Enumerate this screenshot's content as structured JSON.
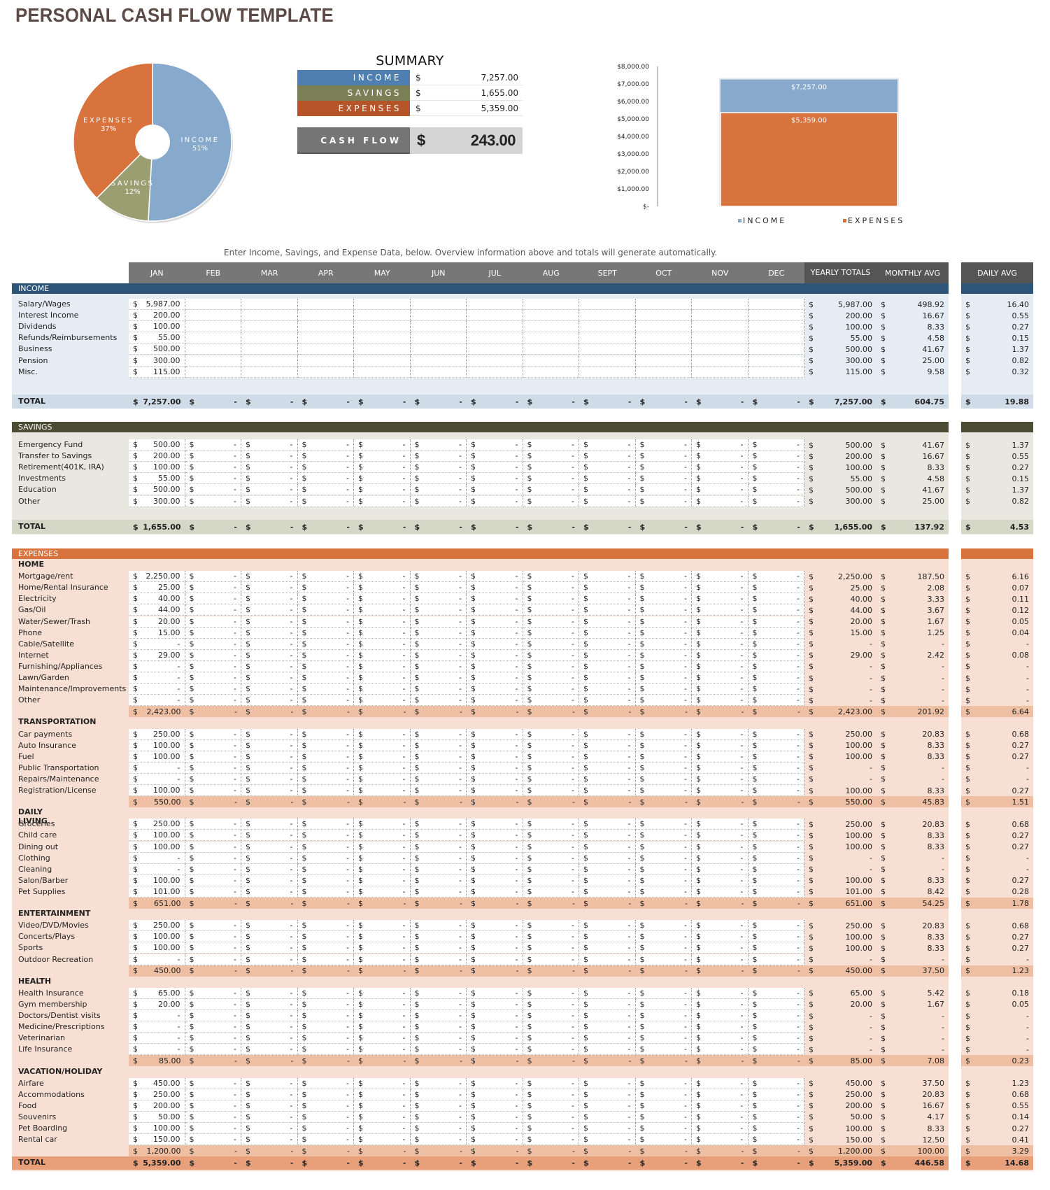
{
  "title": "PERSONAL CASH FLOW TEMPLATE",
  "colors": {
    "income": "#4e7fb0",
    "income_light": "#86a9cc",
    "savings": "#7a7f55",
    "savings_light": "#9a9e71",
    "expenses": "#b6542a",
    "expenses_light": "#d8733e",
    "income_band": "#2e5478",
    "savings_band": "#4a4c34",
    "expenses_band": "#d8733e",
    "income_bg": "#e6ecf3",
    "savings_bg": "#e8e8e0",
    "expenses_bg": "#f7e0d3",
    "income_total": "#cfdbe7",
    "savings_total": "#d5d7c7",
    "expenses_sub": "#eebfa2",
    "expenses_total": "#e8a07a"
  },
  "summary": {
    "title": "SUMMARY",
    "rows": [
      {
        "label": "INCOME",
        "currency": "$",
        "value": "7,257.00"
      },
      {
        "label": "SAVINGS",
        "currency": "$",
        "value": "1,655.00"
      },
      {
        "label": "EXPENSES",
        "currency": "$",
        "value": "5,359.00"
      }
    ],
    "cash_flow": {
      "label": "CASH FLOW",
      "currency": "$",
      "value": "243.00"
    }
  },
  "chart_data": [
    {
      "type": "pie",
      "title": "",
      "donut": true,
      "slices": [
        {
          "label": "INCOME",
          "percent": "51%",
          "value": 7257
        },
        {
          "label": "SAVINGS",
          "percent": "12%",
          "value": 1655
        },
        {
          "label": "EXPENSES",
          "percent": "37%",
          "value": 5359
        }
      ]
    },
    {
      "type": "bar",
      "stacked_overlap": true,
      "categories": [
        ""
      ],
      "series": [
        {
          "name": "INCOME",
          "values": [
            7257
          ],
          "label": "$7,257.00"
        },
        {
          "name": "EXPENSES",
          "values": [
            5359
          ],
          "label": "$5,359.00"
        }
      ],
      "ylim": [
        0,
        8000
      ],
      "yticks": [
        "$-",
        "$1,000.00",
        "$2,000.00",
        "$3,000.00",
        "$4,000.00",
        "$5,000.00",
        "$6,000.00",
        "$7,000.00",
        "$8,000.00"
      ],
      "legend": [
        "INCOME",
        "EXPENSES"
      ],
      "legend_position": "bottom"
    }
  ],
  "instructions": "Enter Income, Savings, and Expense Data, below.  Overview information above and totals will generate automatically.",
  "columns": {
    "months": [
      "JAN",
      "FEB",
      "MAR",
      "APR",
      "MAY",
      "JUN",
      "JUL",
      "AUG",
      "SEPT",
      "OCT",
      "NOV",
      "DEC"
    ],
    "yearly": "YEARLY TOTALS",
    "monthly_avg": "MONTHLY AVG",
    "daily_avg": "DAILY AVG"
  },
  "income": {
    "header": "INCOME",
    "rows": [
      {
        "label": "Salary/Wages",
        "jan": "5,987.00",
        "yearly": "5,987.00",
        "monthly": "498.92",
        "daily": "16.40"
      },
      {
        "label": "Interest Income",
        "jan": "200.00",
        "yearly": "200.00",
        "monthly": "16.67",
        "daily": "0.55"
      },
      {
        "label": "Dividends",
        "jan": "100.00",
        "yearly": "100.00",
        "monthly": "8.33",
        "daily": "0.27"
      },
      {
        "label": "Refunds/Reimbursements",
        "jan": "55.00",
        "yearly": "55.00",
        "monthly": "4.58",
        "daily": "0.15"
      },
      {
        "label": "Business",
        "jan": "500.00",
        "yearly": "500.00",
        "monthly": "41.67",
        "daily": "1.37"
      },
      {
        "label": "Pension",
        "jan": "300.00",
        "yearly": "300.00",
        "monthly": "25.00",
        "daily": "0.82"
      },
      {
        "label": "Misc.",
        "jan": "115.00",
        "yearly": "115.00",
        "monthly": "9.58",
        "daily": "0.32"
      }
    ],
    "total": {
      "label": "TOTAL",
      "jan": "7,257.00",
      "yearly": "7,257.00",
      "monthly": "604.75",
      "daily": "19.88"
    }
  },
  "savings": {
    "header": "SAVINGS",
    "rows": [
      {
        "label": "Emergency Fund",
        "jan": "500.00",
        "yearly": "500.00",
        "monthly": "41.67",
        "daily": "1.37"
      },
      {
        "label": "Transfer to Savings",
        "jan": "200.00",
        "yearly": "200.00",
        "monthly": "16.67",
        "daily": "0.55"
      },
      {
        "label": "Retirement(401K, IRA)",
        "jan": "100.00",
        "yearly": "100.00",
        "monthly": "8.33",
        "daily": "0.27"
      },
      {
        "label": "Investments",
        "jan": "55.00",
        "yearly": "55.00",
        "monthly": "4.58",
        "daily": "0.15"
      },
      {
        "label": "Education",
        "jan": "500.00",
        "yearly": "500.00",
        "monthly": "41.67",
        "daily": "1.37"
      },
      {
        "label": "Other",
        "jan": "300.00",
        "yearly": "300.00",
        "monthly": "25.00",
        "daily": "0.82"
      }
    ],
    "total": {
      "label": "TOTAL",
      "jan": "1,655.00",
      "yearly": "1,655.00",
      "monthly": "137.92",
      "daily": "4.53"
    }
  },
  "expenses": {
    "header": "EXPENSES",
    "categories": [
      {
        "name": "HOME",
        "rows": [
          {
            "label": "Mortgage/rent",
            "jan": "2,250.00",
            "yearly": "2,250.00",
            "monthly": "187.50",
            "daily": "6.16"
          },
          {
            "label": "Home/Rental Insurance",
            "jan": "25.00",
            "yearly": "25.00",
            "monthly": "2.08",
            "daily": "0.07"
          },
          {
            "label": "Electricity",
            "jan": "40.00",
            "yearly": "40.00",
            "monthly": "3.33",
            "daily": "0.11"
          },
          {
            "label": "Gas/Oil",
            "jan": "44.00",
            "yearly": "44.00",
            "monthly": "3.67",
            "daily": "0.12"
          },
          {
            "label": "Water/Sewer/Trash",
            "jan": "20.00",
            "yearly": "20.00",
            "monthly": "1.67",
            "daily": "0.05"
          },
          {
            "label": "Phone",
            "jan": "15.00",
            "yearly": "15.00",
            "monthly": "1.25",
            "daily": "0.04"
          },
          {
            "label": "Cable/Satellite",
            "jan": "-",
            "yearly": "-",
            "monthly": "-",
            "daily": "-"
          },
          {
            "label": "Internet",
            "jan": "29.00",
            "yearly": "29.00",
            "monthly": "2.42",
            "daily": "0.08"
          },
          {
            "label": "Furnishing/Appliances",
            "jan": "-",
            "yearly": "-",
            "monthly": "-",
            "daily": "-"
          },
          {
            "label": "Lawn/Garden",
            "jan": "-",
            "yearly": "-",
            "monthly": "-",
            "daily": "-"
          },
          {
            "label": "Maintenance/Improvements",
            "jan": "-",
            "yearly": "-",
            "monthly": "-",
            "daily": "-"
          },
          {
            "label": "Other",
            "jan": "-",
            "yearly": "-",
            "monthly": "-",
            "daily": "-"
          }
        ],
        "subtotal": {
          "jan": "2,423.00",
          "yearly": "2,423.00",
          "monthly": "201.92",
          "daily": "6.64"
        }
      },
      {
        "name": "TRANSPORTATION",
        "rows": [
          {
            "label": "Car payments",
            "jan": "250.00",
            "yearly": "250.00",
            "monthly": "20.83",
            "daily": "0.68"
          },
          {
            "label": "Auto Insurance",
            "jan": "100.00",
            "yearly": "100.00",
            "monthly": "8.33",
            "daily": "0.27"
          },
          {
            "label": "Fuel",
            "jan": "100.00",
            "yearly": "100.00",
            "monthly": "8.33",
            "daily": "0.27"
          },
          {
            "label": "Public Transportation",
            "jan": "-",
            "yearly": "-",
            "monthly": "-",
            "daily": "-"
          },
          {
            "label": "Repairs/Maintenance",
            "jan": "-",
            "yearly": "-",
            "monthly": "-",
            "daily": "-"
          },
          {
            "label": "Registration/License",
            "jan": "100.00",
            "yearly": "100.00",
            "monthly": "8.33",
            "daily": "0.27"
          }
        ],
        "subtotal": {
          "jan": "550.00",
          "yearly": "550.00",
          "monthly": "45.83",
          "daily": "1.51"
        }
      },
      {
        "name": "DAILY LIVING",
        "rows": [
          {
            "label": "Groceries",
            "jan": "250.00",
            "yearly": "250.00",
            "monthly": "20.83",
            "daily": "0.68"
          },
          {
            "label": "Child care",
            "jan": "100.00",
            "yearly": "100.00",
            "monthly": "8.33",
            "daily": "0.27"
          },
          {
            "label": "Dining out",
            "jan": "100.00",
            "yearly": "100.00",
            "monthly": "8.33",
            "daily": "0.27"
          },
          {
            "label": "Clothing",
            "jan": "-",
            "yearly": "-",
            "monthly": "-",
            "daily": "-"
          },
          {
            "label": "Cleaning",
            "jan": "-",
            "yearly": "-",
            "monthly": "-",
            "daily": "-"
          },
          {
            "label": "Salon/Barber",
            "jan": "100.00",
            "yearly": "100.00",
            "monthly": "8.33",
            "daily": "0.27"
          },
          {
            "label": "Pet Supplies",
            "jan": "101.00",
            "yearly": "101.00",
            "monthly": "8.42",
            "daily": "0.28"
          }
        ],
        "subtotal": {
          "jan": "651.00",
          "yearly": "651.00",
          "monthly": "54.25",
          "daily": "1.78"
        }
      },
      {
        "name": "ENTERTAINMENT",
        "rows": [
          {
            "label": "Video/DVD/Movies",
            "jan": "250.00",
            "yearly": "250.00",
            "monthly": "20.83",
            "daily": "0.68"
          },
          {
            "label": "Concerts/Plays",
            "jan": "100.00",
            "yearly": "100.00",
            "monthly": "8.33",
            "daily": "0.27"
          },
          {
            "label": "Sports",
            "jan": "100.00",
            "yearly": "100.00",
            "monthly": "8.33",
            "daily": "0.27"
          },
          {
            "label": "Outdoor Recreation",
            "jan": "-",
            "yearly": "-",
            "monthly": "-",
            "daily": "-"
          }
        ],
        "subtotal": {
          "jan": "450.00",
          "yearly": "450.00",
          "monthly": "37.50",
          "daily": "1.23"
        }
      },
      {
        "name": "HEALTH",
        "rows": [
          {
            "label": "Health Insurance",
            "jan": "65.00",
            "yearly": "65.00",
            "monthly": "5.42",
            "daily": "0.18"
          },
          {
            "label": "Gym membership",
            "jan": "20.00",
            "yearly": "20.00",
            "monthly": "1.67",
            "daily": "0.05"
          },
          {
            "label": "Doctors/Dentist visits",
            "jan": "-",
            "yearly": "-",
            "monthly": "-",
            "daily": "-"
          },
          {
            "label": "Medicine/Prescriptions",
            "jan": "-",
            "yearly": "-",
            "monthly": "-",
            "daily": "-"
          },
          {
            "label": "Veterinarian",
            "jan": "-",
            "yearly": "-",
            "monthly": "-",
            "daily": "-"
          },
          {
            "label": "Life Insurance",
            "jan": "-",
            "yearly": "-",
            "monthly": "-",
            "daily": "-"
          }
        ],
        "subtotal": {
          "jan": "85.00",
          "yearly": "85.00",
          "monthly": "7.08",
          "daily": "0.23"
        }
      },
      {
        "name": "VACATION/HOLIDAY",
        "rows": [
          {
            "label": "Airfare",
            "jan": "450.00",
            "yearly": "450.00",
            "monthly": "37.50",
            "daily": "1.23"
          },
          {
            "label": "Accommodations",
            "jan": "250.00",
            "yearly": "250.00",
            "monthly": "20.83",
            "daily": "0.68"
          },
          {
            "label": "Food",
            "jan": "200.00",
            "yearly": "200.00",
            "monthly": "16.67",
            "daily": "0.55"
          },
          {
            "label": "Souvenirs",
            "jan": "50.00",
            "yearly": "50.00",
            "monthly": "4.17",
            "daily": "0.14"
          },
          {
            "label": "Pet Boarding",
            "jan": "100.00",
            "yearly": "100.00",
            "monthly": "8.33",
            "daily": "0.27"
          },
          {
            "label": "Rental car",
            "jan": "150.00",
            "yearly": "150.00",
            "monthly": "12.50",
            "daily": "0.41"
          }
        ],
        "subtotal": {
          "jan": "1,200.00",
          "yearly": "1,200.00",
          "monthly": "100.00",
          "daily": "3.29"
        }
      }
    ],
    "total": {
      "label": "TOTAL",
      "jan": "5,359.00",
      "yearly": "5,359.00",
      "monthly": "446.58",
      "daily": "14.68"
    }
  },
  "empty_month_value": "-",
  "currency_symbol": "$"
}
